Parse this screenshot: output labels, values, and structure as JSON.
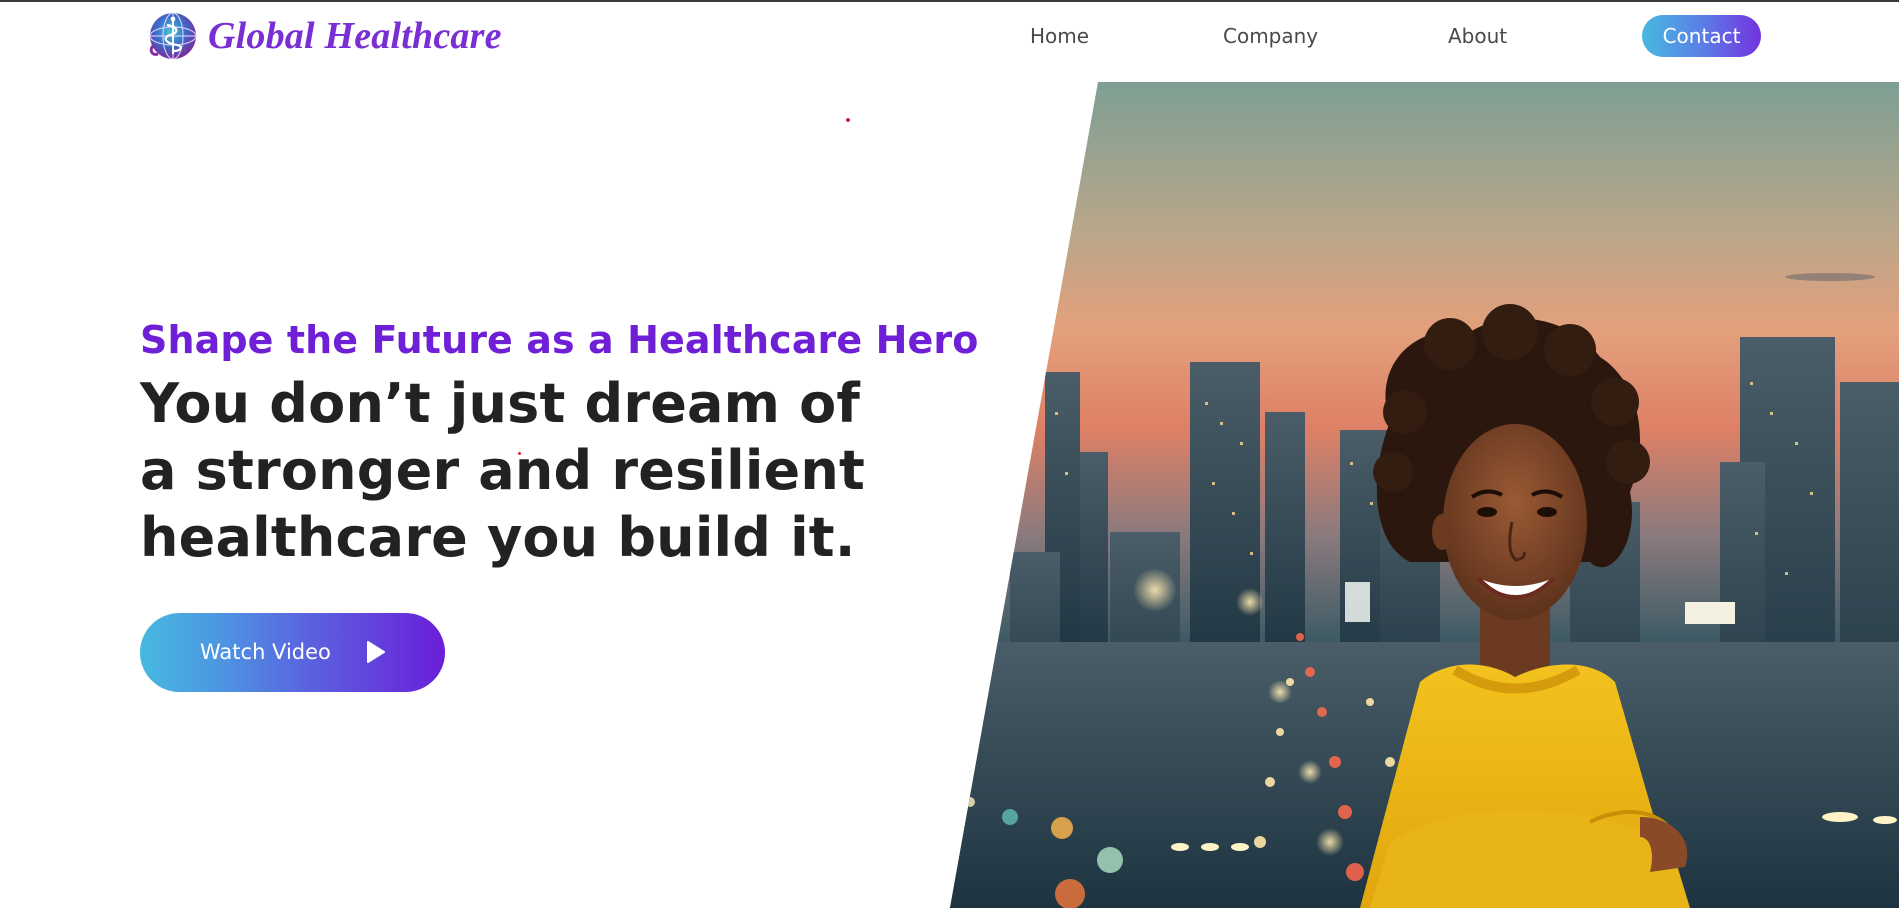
{
  "brand": {
    "name": "Global Healthcare",
    "logo_icon": "globe-caduceus-icon",
    "accent": "#7a2fd4"
  },
  "nav": {
    "home": "Home",
    "company": "Company",
    "about": "About",
    "contact": "Contact"
  },
  "hero": {
    "subtitle": "Shape the Future as a Healthcare Hero",
    "headline": "You don’t just dream of a stronger and resilient healthcare you build it.",
    "watch_button": "Watch Video",
    "watch_icon": "play-icon",
    "image_alt": "smiling-woman-city-skyline"
  },
  "colors": {
    "gradient_start": "#46b9e0",
    "gradient_end": "#6a1ed8",
    "subtitle": "#6f1fd6",
    "headline": "#222222"
  }
}
